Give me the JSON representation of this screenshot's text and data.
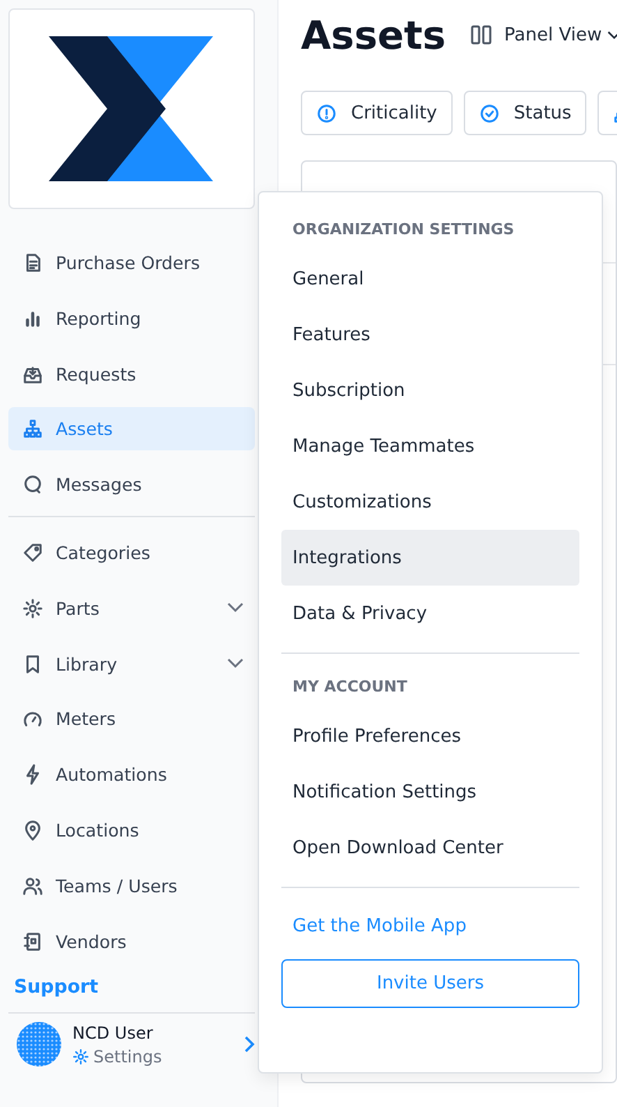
{
  "sidebar": {
    "groups": [
      {
        "items": [
          {
            "label": "Purchase Orders",
            "selected": false,
            "expandable": false
          },
          {
            "label": "Reporting",
            "selected": false,
            "expandable": false
          },
          {
            "label": "Requests",
            "selected": false,
            "expandable": false
          },
          {
            "label": "Assets",
            "selected": true,
            "expandable": false
          },
          {
            "label": "Messages",
            "selected": false,
            "expandable": false
          }
        ]
      },
      {
        "items": [
          {
            "label": "Categories",
            "selected": false,
            "expandable": false
          },
          {
            "label": "Parts",
            "selected": false,
            "expandable": true
          },
          {
            "label": "Library",
            "selected": false,
            "expandable": true
          },
          {
            "label": "Meters",
            "selected": false,
            "expandable": false
          },
          {
            "label": "Automations",
            "selected": false,
            "expandable": false
          },
          {
            "label": "Locations",
            "selected": false,
            "expandable": false
          },
          {
            "label": "Teams / Users",
            "selected": false,
            "expandable": false
          },
          {
            "label": "Vendors",
            "selected": false,
            "expandable": false
          }
        ]
      }
    ],
    "support": "Support",
    "user": {
      "name": "NCD User",
      "settings": "Settings"
    }
  },
  "page": {
    "title": "Assets",
    "view": "Panel View",
    "filters": [
      {
        "kind": "labeled",
        "label": "Criticality"
      },
      {
        "kind": "labeled",
        "label": "Status"
      },
      {
        "kind": "icon_only"
      }
    ]
  },
  "menu": {
    "sections": [
      {
        "heading": "ORGANIZATION SETTINGS",
        "items": [
          {
            "label": "General",
            "hovered": false
          },
          {
            "label": "Features",
            "hovered": false
          },
          {
            "label": "Subscription",
            "hovered": false
          },
          {
            "label": "Manage Teammates",
            "hovered": false
          },
          {
            "label": "Customizations",
            "hovered": false
          },
          {
            "label": "Integrations",
            "hovered": true
          },
          {
            "label": "Data & Privacy",
            "hovered": false
          }
        ]
      },
      {
        "heading": "MY ACCOUNT",
        "items": [
          {
            "label": "Profile Preferences",
            "hovered": false
          },
          {
            "label": "Notification Settings",
            "hovered": false
          },
          {
            "label": "Open Download Center",
            "hovered": false
          }
        ]
      }
    ],
    "link": "Get the Mobile App",
    "button": "Invite Users"
  }
}
